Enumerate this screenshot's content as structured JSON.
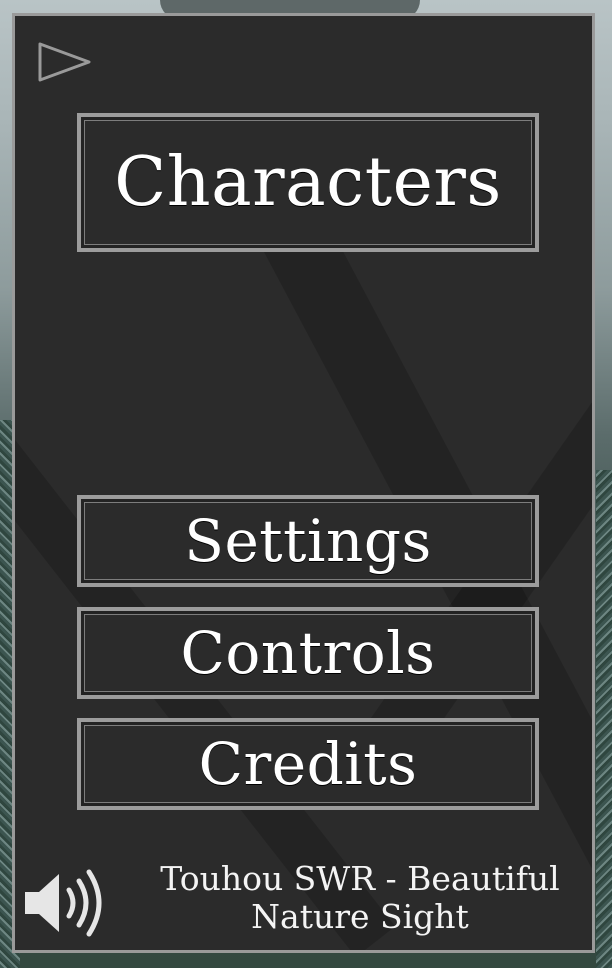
{
  "menu": {
    "characters_label": "Characters",
    "settings_label": "Settings",
    "controls_label": "Controls",
    "credits_label": "Credits"
  },
  "toolbar": {
    "play_icon": "play-outline-icon",
    "speaker_icon": "speaker-volume-icon"
  },
  "now_playing": {
    "line1": "Touhou SWR - Beautiful",
    "line2": "Nature Sight"
  },
  "colors": {
    "panel_bg": "#2b2b2b",
    "border": "#9c9c9c",
    "text": "#ffffff"
  }
}
